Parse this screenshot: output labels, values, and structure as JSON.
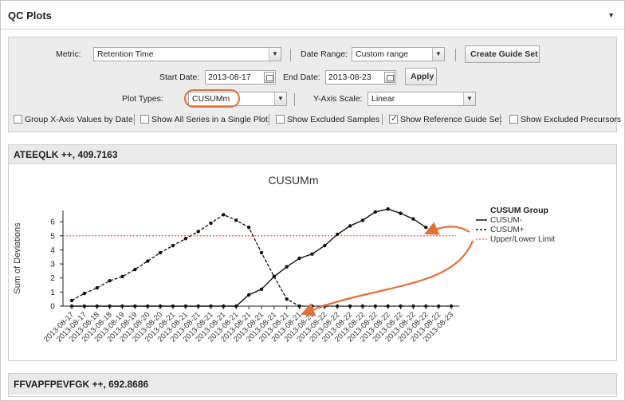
{
  "panel": {
    "title": "QC Plots",
    "menu_icon": "triangle-down-icon"
  },
  "toolbar": {
    "metric_label": "Metric:",
    "metric_value": "Retention Time",
    "date_range_label": "Date Range:",
    "date_range_value": "Custom range",
    "create_guide_set": "Create Guide Set",
    "start_date_label": "Start Date:",
    "start_date_value": "2013-08-17",
    "end_date_label": "End Date:",
    "end_date_value": "2013-08-23",
    "apply": "Apply",
    "plot_types_label": "Plot Types:",
    "plot_types_value": "CUSUMm",
    "y_axis_scale_label": "Y-Axis Scale:",
    "y_axis_scale_value": "Linear",
    "checkboxes": [
      {
        "label": "Group X-Axis Values by Date",
        "checked": false
      },
      {
        "label": "Show All Series in a Single Plot",
        "checked": false
      },
      {
        "label": "Show Excluded Samples",
        "checked": false
      },
      {
        "label": "Show Reference Guide Set",
        "checked": true
      },
      {
        "label": "Show Excluded Precursors",
        "checked": false
      }
    ]
  },
  "plots": [
    {
      "header": "ATEEQLK ++, 409.7163"
    },
    {
      "header": "FFVAPFPEVFGK ++, 692.8686"
    }
  ],
  "colors": {
    "accent_orange": "#e0703c",
    "limit_red": "#e53b3b"
  },
  "chart_data": {
    "type": "line",
    "title": "CUSUMm",
    "ylabel": "Sum of Deviations",
    "xlabel": "",
    "ylim": [
      0,
      6.8
    ],
    "yticks": [
      0,
      1,
      2,
      3,
      4,
      5,
      6
    ],
    "categories": [
      "2013-08-17",
      "2013-08-17",
      "2013-08-18",
      "2013-08-18",
      "2013-08-19",
      "2013-08-19",
      "2013-08-20",
      "2013-08-20",
      "2013-08-21",
      "2013-08-21",
      "2013-08-21",
      "2013-08-21",
      "2013-08-21",
      "2013-08-21",
      "2013-08-21",
      "2013-08-21",
      "2013-08-21",
      "2013-08-21",
      "2013-08-21",
      "2013-08-21",
      "2013-08-22",
      "2013-08-22",
      "2013-08-22",
      "2013-08-22",
      "2013-08-22",
      "2013-08-22",
      "2013-08-22",
      "2013-08-22",
      "2013-08-22",
      "2013-08-22",
      "2013-08-23"
    ],
    "legend": {
      "title": "CUSUM Group",
      "placement": "right"
    },
    "series": [
      {
        "name": "CUSUM-",
        "style": "solid",
        "values": [
          0,
          0,
          0,
          0,
          0,
          0,
          0,
          0,
          0,
          0,
          0,
          0,
          0,
          0,
          0.8,
          1.2,
          2.1,
          2.8,
          3.4,
          3.7,
          4.3,
          5.1,
          5.7,
          6.1,
          6.7,
          6.9,
          6.6,
          6.2,
          5.6,
          null,
          null
        ]
      },
      {
        "name": "CUSUM+",
        "style": "dashed",
        "values": [
          0.4,
          0.9,
          1.3,
          1.8,
          2.1,
          2.6,
          3.2,
          3.8,
          4.3,
          4.8,
          5.3,
          5.9,
          6.5,
          6.1,
          5.6,
          3.8,
          2.1,
          0.5,
          0,
          0,
          0,
          0,
          0,
          0,
          0,
          0,
          0,
          0,
          0,
          0,
          0
        ]
      },
      {
        "name": "Upper/Lower Limit",
        "style": "dotted",
        "constant": 5
      }
    ]
  }
}
